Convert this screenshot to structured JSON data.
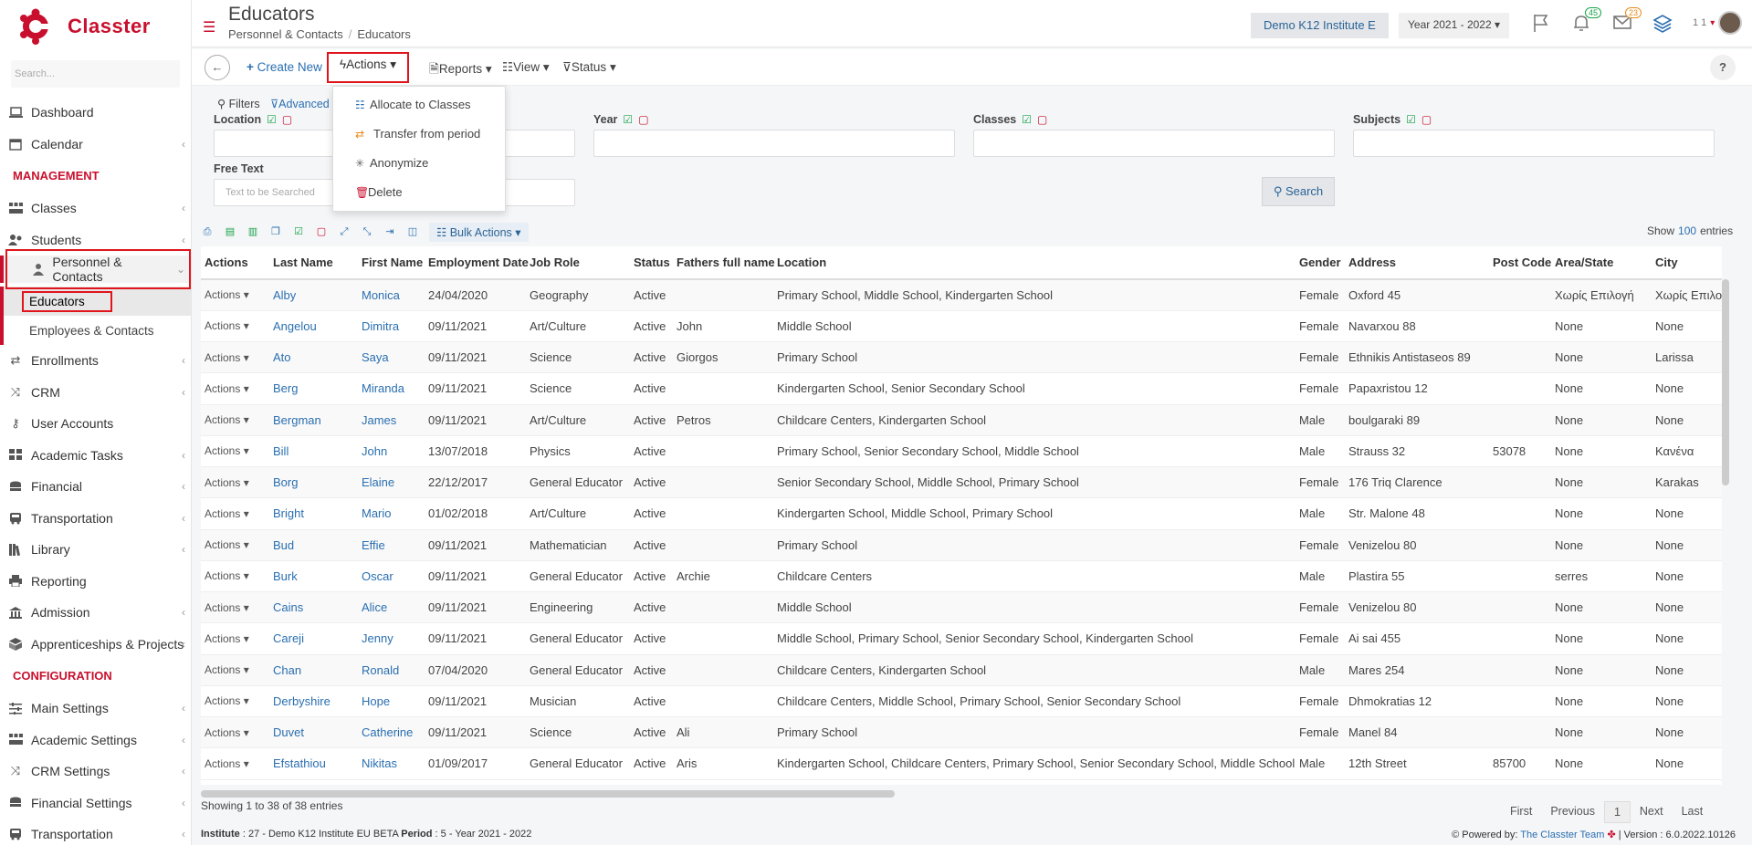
{
  "app": {
    "name": "Classter",
    "search_placeholder": "Search..."
  },
  "sidebar": {
    "items": [
      {
        "label": "Dashboard",
        "icon": "laptop-icon",
        "chev": false
      },
      {
        "label": "Calendar",
        "icon": "calendar-icon",
        "chev": true
      }
    ],
    "section_management": "MANAGEMENT",
    "management": [
      {
        "label": "Classes",
        "icon": "classes-icon",
        "chev": true
      },
      {
        "label": "Students",
        "icon": "students-icon",
        "chev": true
      }
    ],
    "personnel": {
      "label": "Personnel & Contacts",
      "sub": [
        "Educators",
        "Employees & Contacts"
      ]
    },
    "management2": [
      {
        "label": "Enrollments",
        "icon": "enrollments-icon",
        "chev": true
      },
      {
        "label": "CRM",
        "icon": "crm-icon",
        "chev": true
      },
      {
        "label": "User Accounts",
        "icon": "key-icon",
        "chev": false
      },
      {
        "label": "Academic Tasks",
        "icon": "tasks-icon",
        "chev": true
      },
      {
        "label": "Financial",
        "icon": "coins-icon",
        "chev": true
      },
      {
        "label": "Transportation",
        "icon": "bus-icon",
        "chev": true
      },
      {
        "label": "Library",
        "icon": "library-icon",
        "chev": true
      },
      {
        "label": "Reporting",
        "icon": "print-icon",
        "chev": false
      },
      {
        "label": "Admission",
        "icon": "institution-icon",
        "chev": true
      },
      {
        "label": "Apprenticeships & Projects",
        "icon": "projects-icon",
        "chev": true
      }
    ],
    "section_configuration": "CONFIGURATION",
    "configuration": [
      {
        "label": "Main Settings",
        "icon": "settings-icon",
        "chev": true
      },
      {
        "label": "Academic Settings",
        "icon": "classes-icon",
        "chev": true
      },
      {
        "label": "CRM Settings",
        "icon": "crm-icon",
        "chev": true
      },
      {
        "label": "Financial Settings",
        "icon": "coins-icon",
        "chev": true
      },
      {
        "label": "Transportation",
        "icon": "bus-icon",
        "chev": true
      }
    ]
  },
  "header": {
    "title": "Educators",
    "breadcrumb": [
      "Personnel & Contacts",
      "Educators"
    ],
    "institute": "Demo K12 Institute E",
    "year": "Year 2021 - 2022",
    "notif_count": "45",
    "mail_count": "23",
    "user_count": "1 1"
  },
  "toolbar": {
    "create": "Create New",
    "actions": "Actions",
    "reports": "Reports",
    "view": "View",
    "status": "Status",
    "help": "?"
  },
  "actions_menu": [
    "Allocate to Classes",
    "Transfer from period",
    "Anonymize",
    "Delete"
  ],
  "filters": {
    "filters_label": "Filters",
    "advanced_label": "Advanced",
    "location": "Location",
    "year": "Year",
    "classes": "Classes",
    "subjects": "Subjects",
    "free_text": "Free Text",
    "free_text_placeholder": "Text to be Searched",
    "search_btn": "Search"
  },
  "grid": {
    "bulk_actions": "Bulk Actions",
    "show_label": "Show",
    "show_count": "100",
    "entries_label": "entries",
    "columns": [
      "Actions",
      "Last Name",
      "First Name",
      "Employment Date",
      "Job Role",
      "Status",
      "Fathers full name",
      "Location",
      "Gender",
      "Address",
      "Post Code",
      "Area/State",
      "City"
    ],
    "rows": [
      [
        "Actions",
        "Alby",
        "Monica",
        "24/04/2020",
        "Geography",
        "Active",
        "",
        "Primary School, Middle School, Kindergarten School",
        "Female",
        "Oxford 45",
        "",
        "Χωρίς Επιλογή",
        "Χωρίς Επιλογή"
      ],
      [
        "Actions",
        "Angelou",
        "Dimitra",
        "09/11/2021",
        "Art/Culture",
        "Active",
        "John",
        "Middle School",
        "Female",
        "Navarxou 88",
        "",
        "None",
        "None"
      ],
      [
        "Actions",
        "Ato",
        "Saya",
        "09/11/2021",
        "Science",
        "Active",
        "Giorgos",
        "Primary School",
        "Female",
        "Ethnikis Antistaseos 89",
        "",
        "None",
        "Larissa"
      ],
      [
        "Actions",
        "Berg",
        "Miranda",
        "09/11/2021",
        "Science",
        "Active",
        "",
        "Kindergarten School, Senior Secondary School",
        "Female",
        "Papaxristou 12",
        "",
        "None",
        "None"
      ],
      [
        "Actions",
        "Bergman",
        "James",
        "09/11/2021",
        "Art/Culture",
        "Active",
        "Petros",
        "Childcare Centers, Kindergarten School",
        "Male",
        "boulgaraki 89",
        "",
        "None",
        "None"
      ],
      [
        "Actions",
        "Bill",
        "John",
        "13/07/2018",
        "Physics",
        "Active",
        "",
        "Primary School, Senior Secondary School, Middle School",
        "Male",
        "Strauss 32",
        "53078",
        "None",
        "Κανένα"
      ],
      [
        "Actions",
        "Borg",
        "Elaine",
        "22/12/2017",
        "General Educator",
        "Active",
        "",
        "Senior Secondary School, Middle School, Primary School",
        "Female",
        "176 Triq Clarence",
        "",
        "None",
        "Karakas"
      ],
      [
        "Actions",
        "Bright",
        "Mario",
        "01/02/2018",
        "Art/Culture",
        "Active",
        "",
        "Kindergarten School, Middle School, Primary School",
        "Male",
        "Str. Malone 48",
        "",
        "None",
        "None"
      ],
      [
        "Actions",
        "Bud",
        "Effie",
        "09/11/2021",
        "Mathematician",
        "Active",
        "",
        "Primary School",
        "Female",
        "Venizelou 80",
        "",
        "None",
        "None"
      ],
      [
        "Actions",
        "Burk",
        "Oscar",
        "09/11/2021",
        "General Educator",
        "Active",
        "Archie",
        "Childcare Centers",
        "Male",
        "Plastira 55",
        "",
        "serres",
        "None"
      ],
      [
        "Actions",
        "Cains",
        "Alice",
        "09/11/2021",
        "Engineering",
        "Active",
        "",
        "Middle School",
        "Female",
        "Venizelou 80",
        "",
        "None",
        "None"
      ],
      [
        "Actions",
        "Careji",
        "Jenny",
        "09/11/2021",
        "General Educator",
        "Active",
        "",
        "Middle School, Primary School, Senior Secondary School, Kindergarten School",
        "Female",
        "Ai sai 455",
        "",
        "None",
        "None"
      ],
      [
        "Actions",
        "Chan",
        "Ronald",
        "07/04/2020",
        "General Educator",
        "Active",
        "",
        "Childcare Centers, Kindergarten School",
        "Male",
        "Mares 254",
        "",
        "None",
        "None"
      ],
      [
        "Actions",
        "Derbyshire",
        "Hope",
        "09/11/2021",
        "Musician",
        "Active",
        "",
        "Childcare Centers, Middle School, Primary School, Senior Secondary School",
        "Female",
        "Dhmokratias 12",
        "",
        "None",
        "None"
      ],
      [
        "Actions",
        "Duvet",
        "Catherine",
        "09/11/2021",
        "Science",
        "Active",
        "Ali",
        "Primary School",
        "Female",
        "Manel 84",
        "",
        "None",
        "None"
      ],
      [
        "Actions",
        "Efstathiou",
        "Nikitas",
        "01/09/2017",
        "General Educator",
        "Active",
        "Aris",
        "Kindergarten School, Childcare Centers, Primary School, Senior Secondary School, Middle School",
        "Male",
        "12th Street",
        "85700",
        "None",
        "None"
      ]
    ],
    "showing": "Showing 1 to 38 of 38 entries",
    "pager": [
      "First",
      "Previous",
      "1",
      "Next",
      "Last"
    ]
  },
  "footer": {
    "institute_label": "Institute",
    "institute_value": " : 27 - Demo K12 Institute EU BETA ",
    "period_label": "Period",
    "period_value": " : 5 - Year 2021 - 2022",
    "powered_by": "Powered by:",
    "team": "The Classter Team",
    "version": "| Version : 6.0.2022.10126"
  },
  "colors": {
    "brand": "#c8102e",
    "link": "#2a6fb0",
    "highlight_border": "#e0151c"
  }
}
